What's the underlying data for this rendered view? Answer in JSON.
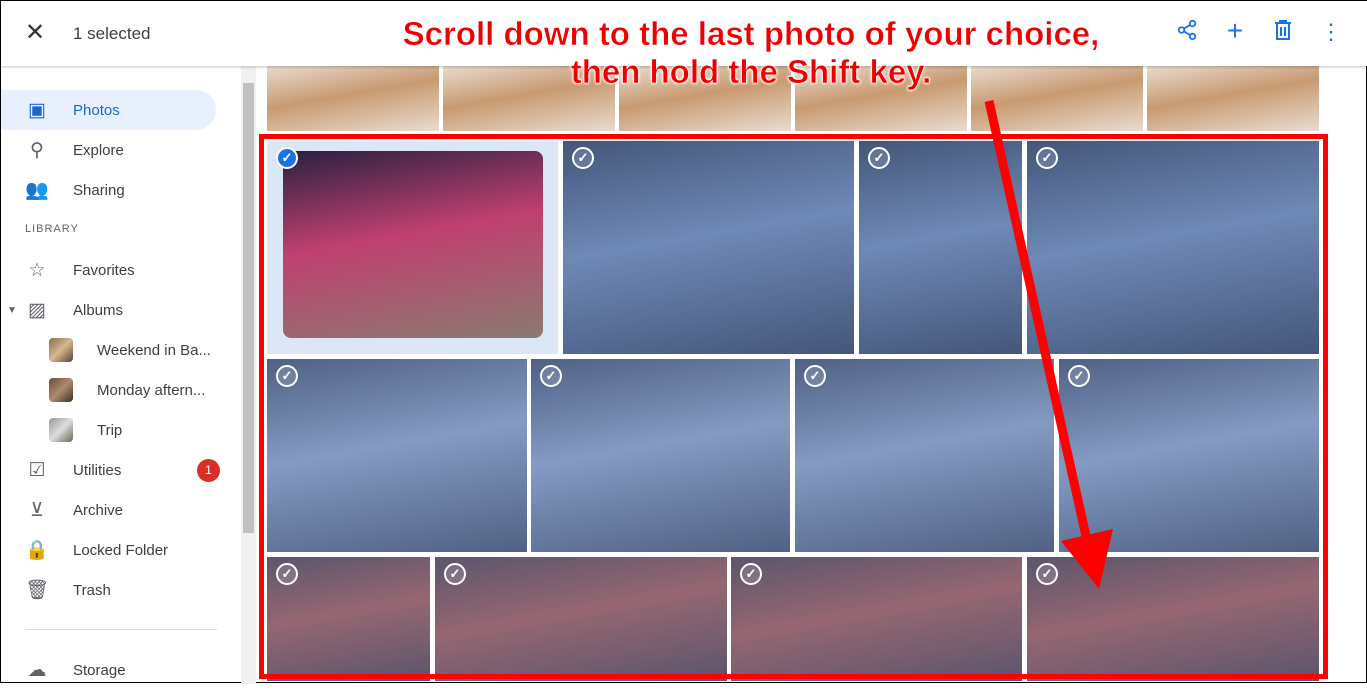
{
  "header": {
    "close_icon": "close-icon",
    "selection_label": "1 selected",
    "actions": [
      {
        "name": "share",
        "glyph": "⋖"
      },
      {
        "name": "add",
        "glyph": "+"
      },
      {
        "name": "delete",
        "glyph": "🗑"
      },
      {
        "name": "more",
        "glyph": "⋮"
      }
    ]
  },
  "annotation": {
    "line1": "Scroll down to the last photo of your choice,",
    "line2": "then hold the Shift key.",
    "color": "#ff0000"
  },
  "sidebar": {
    "items": [
      {
        "label": "Photos",
        "icon": "▣",
        "active": true
      },
      {
        "label": "Explore",
        "icon": "⚲"
      },
      {
        "label": "Sharing",
        "icon": "👥"
      }
    ],
    "library_heading": "LIBRARY",
    "library": [
      {
        "label": "Favorites",
        "icon": "☆"
      },
      {
        "label": "Albums",
        "icon": "▨"
      }
    ],
    "albums": [
      {
        "label": "Weekend in Ba..."
      },
      {
        "label": "Monday aftern..."
      },
      {
        "label": "Trip"
      }
    ],
    "more": [
      {
        "label": "Utilities",
        "icon": "☑",
        "badge": "1"
      },
      {
        "label": "Archive",
        "icon": "⊻"
      },
      {
        "label": "Locked Folder",
        "icon": "🔒"
      },
      {
        "label": "Trash",
        "icon": "🗑"
      }
    ],
    "storage": {
      "label": "Storage",
      "icon": "☁"
    }
  },
  "colors": {
    "accent": "#1a73e8",
    "badge": "#d93025"
  }
}
